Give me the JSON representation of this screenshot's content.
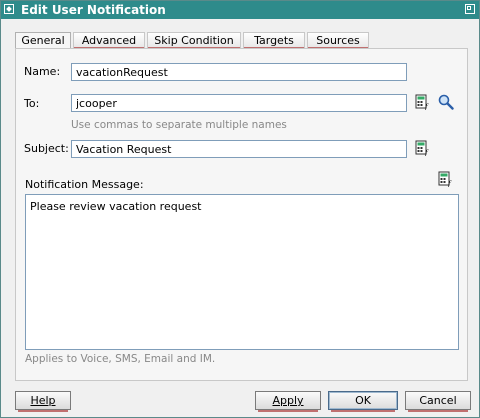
{
  "window": {
    "title": "Edit User Notification"
  },
  "tabs": [
    {
      "label": "General",
      "active": true
    },
    {
      "label": "Advanced"
    },
    {
      "label": "Skip Condition"
    },
    {
      "label": "Targets"
    },
    {
      "label": "Sources"
    }
  ],
  "form": {
    "name_label": "Name:",
    "name_value": "vacationRequest",
    "to_label": "To:",
    "to_value": "jcooper",
    "to_hint": "Use commas to separate multiple names",
    "subject_label": "Subject:",
    "subject_value": "Vacation Request",
    "message_label": "Notification Message:",
    "message_value": "Please review vacation request",
    "applies_hint": "Applies to Voice, SMS, Email and IM."
  },
  "buttons": {
    "help": "Help",
    "apply": "Apply",
    "ok": "OK",
    "cancel": "Cancel"
  },
  "icons": {
    "expression_builder": "expression-builder-icon",
    "search": "search-icon"
  },
  "colors": {
    "titlebar": "#2e8b8b",
    "tab_underline": "#c07070",
    "field_border": "#7f9db9"
  }
}
